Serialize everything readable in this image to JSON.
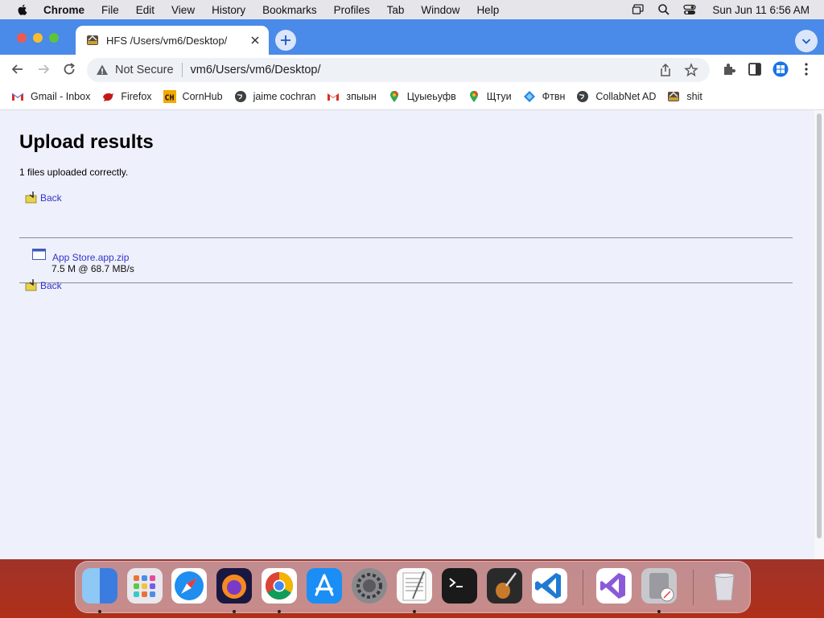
{
  "menubar": {
    "app": "Chrome",
    "items": [
      "File",
      "Edit",
      "View",
      "History",
      "Bookmarks",
      "Profiles",
      "Tab",
      "Window",
      "Help"
    ],
    "clock": "Sun Jun 11  6:56 AM"
  },
  "tab": {
    "title": "HFS /Users/vm6/Desktop/"
  },
  "omnibox": {
    "security": "Not Secure",
    "url": "vm6/Users/vm6/Desktop/"
  },
  "bookmarks": [
    {
      "label": "Gmail - Inbox",
      "icon": "gmail-icon"
    },
    {
      "label": "Firefox",
      "icon": "red-bird-icon"
    },
    {
      "label": "CornHub",
      "icon": "ch-icon"
    },
    {
      "label": "jaime cochran",
      "icon": "globe-icon"
    },
    {
      "label": "зпыын",
      "icon": "gmail-icon"
    },
    {
      "label": "Цуыеьуфв",
      "icon": "maps-pin-icon"
    },
    {
      "label": "Щтуи",
      "icon": "maps-pin-icon"
    },
    {
      "label": "Фтвн",
      "icon": "diamond-icon"
    },
    {
      "label": "CollabNet AD",
      "icon": "globe-icon"
    },
    {
      "label": "shit",
      "icon": "hfs-icon"
    }
  ],
  "page": {
    "title": "Upload results",
    "status": "1 files uploaded correctly.",
    "back_label": "Back",
    "file": {
      "name": "App Store.app.zip",
      "stats": "7.5 M @ 68.7 MB/s"
    }
  },
  "dock": {
    "apps": [
      "finder-icon",
      "launchpad-icon",
      "safari-icon",
      "firefox-icon",
      "chrome-icon",
      "app-store-icon",
      "system-preferences-icon",
      "textedit-icon",
      "terminal-icon",
      "garageband-icon",
      "vscode-icon",
      "visual-studio-icon",
      "directory-utility-icon",
      "trash-icon"
    ]
  }
}
